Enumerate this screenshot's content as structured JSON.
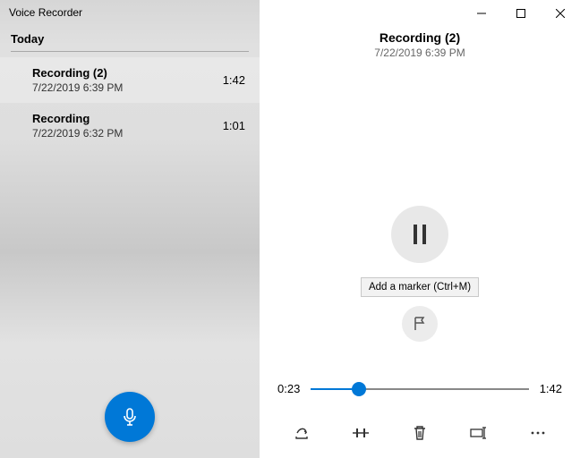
{
  "app": {
    "title": "Voice Recorder"
  },
  "sidebar": {
    "section": "Today",
    "recordings": [
      {
        "name": "Recording (2)",
        "date": "7/22/2019 6:39 PM",
        "duration": "1:42",
        "selected": true
      },
      {
        "name": "Recording",
        "date": "7/22/2019 6:32 PM",
        "duration": "1:01",
        "selected": false
      }
    ]
  },
  "playback": {
    "title": "Recording (2)",
    "subtitle": "7/22/2019 6:39 PM",
    "current_time": "0:23",
    "total_time": "1:42",
    "progress_percent": 22
  },
  "tooltip": {
    "text": "Add a marker (Ctrl+M)"
  },
  "colors": {
    "accent": "#0078d7"
  }
}
